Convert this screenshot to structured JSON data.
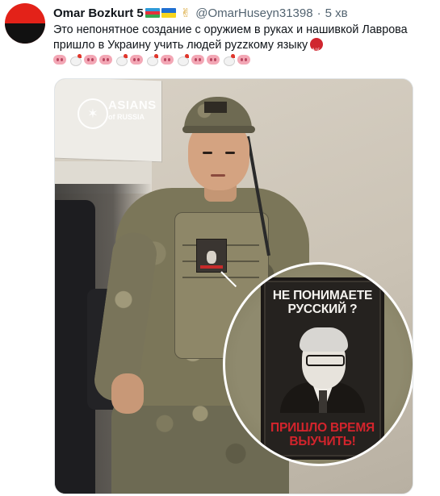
{
  "tweet": {
    "author_name": "Omar Bozkurt 5",
    "flag_1": "flag-azerbaijan-icon",
    "flag_2": "flag-ukraine-icon",
    "handle": "@OmarHuseyn31398",
    "separator": "·",
    "time": "5 хв",
    "text": "Это непонятное создание с оружием в руках и нашивкой Лаврова пришло в Украину учить людей руzzкому языку",
    "emoji_sequence": [
      "pig-nose",
      "chicken",
      "pig-nose",
      "pig-nose",
      "chicken",
      "pig-nose",
      "chicken",
      "pig-nose",
      "chicken",
      "pig-nose",
      "pig-nose",
      "chicken",
      "pig-nose"
    ]
  },
  "media": {
    "watermark_title": "ASIANS",
    "watermark_subtitle": "of RUSSIA",
    "patch_top_text_line1": "НЕ ПОНИМАЕТЕ",
    "patch_top_text_line2": "РУССКИЙ ?",
    "patch_bottom_text_line1": "ПРИШЛО ВРЕМЯ",
    "patch_bottom_text_line2": "ВЫУЧИТЬ!"
  },
  "colors": {
    "text_primary": "#0f1419",
    "text_secondary": "#536471",
    "avatar_top": "#e32219",
    "avatar_bottom": "#111111",
    "patch_red": "#d3242c"
  }
}
